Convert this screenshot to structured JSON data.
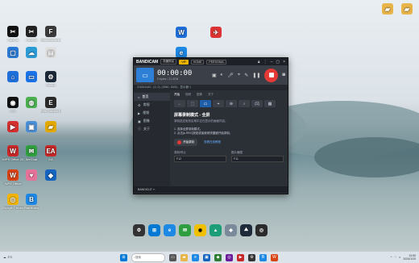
{
  "desktop_icons": [
    {
      "label": "CapCut",
      "icon": "capcut-icon",
      "color": "#111111",
      "glyph": "✂"
    },
    {
      "label": "CapCut",
      "icon": "capcut-icon",
      "color": "#222222",
      "glyph": "✂"
    },
    {
      "label": "Wondershare Filmora",
      "icon": "filmora-icon",
      "color": "#3a3a3a",
      "glyph": "F"
    },
    {
      "label": "",
      "icon": "app-icon",
      "color": "#2b7bd6",
      "glyph": "▢"
    },
    {
      "label": "",
      "icon": "app-icon",
      "color": "#2b9bd6",
      "glyph": "☁"
    },
    {
      "label": "",
      "icon": "doc-icon",
      "color": "#e0e0e0",
      "glyph": "▤"
    },
    {
      "label": "",
      "icon": "network-icon",
      "color": "#1e6fd9",
      "glyph": "⌂"
    },
    {
      "label": "",
      "icon": "display-icon",
      "color": "#1a73e8",
      "glyph": "▭"
    },
    {
      "label": "Steam",
      "icon": "steam-icon",
      "color": "#1b2838",
      "glyph": "⚙"
    },
    {
      "label": "QQ",
      "icon": "qq-icon",
      "color": "#111111",
      "glyph": "◉"
    },
    {
      "label": "",
      "icon": "browser-icon",
      "color": "#4caf50",
      "glyph": "◍"
    },
    {
      "label": "Epic Games Launcher",
      "icon": "epic-icon",
      "color": "#2a2a2a",
      "glyph": "E"
    },
    {
      "label": "",
      "icon": "video-icon",
      "color": "#d32f2f",
      "glyph": "▶"
    },
    {
      "label": "",
      "icon": "photo-icon",
      "color": "#4a90d9",
      "glyph": "▣"
    },
    {
      "label": "",
      "icon": "folder-icon",
      "color": "#e0a800",
      "glyph": "▰"
    },
    {
      "label": "WPS Office 2019",
      "icon": "wps-icon",
      "color": "#c62828",
      "glyph": "W"
    },
    {
      "label": "WeChat",
      "icon": "wechat-icon",
      "color": "#2e9e3e",
      "glyph": "✉"
    },
    {
      "label": "EA",
      "icon": "ea-icon",
      "color": "#c62828",
      "glyph": "EA"
    },
    {
      "label": "WPS Office",
      "icon": "wps-icon",
      "color": "#d84315",
      "glyph": "W"
    },
    {
      "label": "",
      "icon": "app-icon",
      "color": "#e57399",
      "glyph": "♥"
    },
    {
      "label": "",
      "icon": "app-icon",
      "color": "#1565c0",
      "glyph": "◆"
    },
    {
      "label": "Google Chrome",
      "icon": "chrome-icon",
      "color": "#f2b400",
      "glyph": "◎"
    },
    {
      "label": "Bandicam",
      "icon": "bandicam-icon",
      "color": "#1e88e5",
      "glyph": "B"
    }
  ],
  "window": {
    "logo": "BANDICAM",
    "title_buttons": [
      "机器购买",
      "VIP",
      "HOME",
      "PERSONAL"
    ],
    "timer": "00:00:00",
    "size": "0 bytes / 21.0GB",
    "info": "2160x1440 - (0, 0), (2560, 1600) - 显示器 1",
    "sidebar": [
      "首页",
      "常规",
      "视频",
      "图像",
      "关于"
    ],
    "tabs": [
      "开始",
      "视频",
      "图像",
      "关于"
    ],
    "heading": "屏幕录制模式 - 全屏",
    "desc": "录制选定矩形区域中正在显示的画面内容。",
    "steps": [
      "1. 选择全屏录制模式。",
      "2. 点击[● REC]按钮或者使用快捷键开始录制。"
    ],
    "start_label": "开始录制",
    "link": "查看在线教程",
    "hotkey_rec_label": "录制/停止",
    "hotkey_rec_value": "F12",
    "hotkey_img_label": "图片截图",
    "hotkey_img_value": "F11",
    "footer": "BANDICUT ✂"
  },
  "top_right_icons": [
    {
      "label": "",
      "icon": "folder-icon",
      "color": "#e8b54a"
    },
    {
      "label": "",
      "icon": "folder-icon",
      "color": "#e8b54a"
    }
  ],
  "taskbar": {
    "weather": "3°C",
    "weather_sub": "",
    "search": "搜索",
    "time": "13:50",
    "date": "2024/1/20"
  }
}
